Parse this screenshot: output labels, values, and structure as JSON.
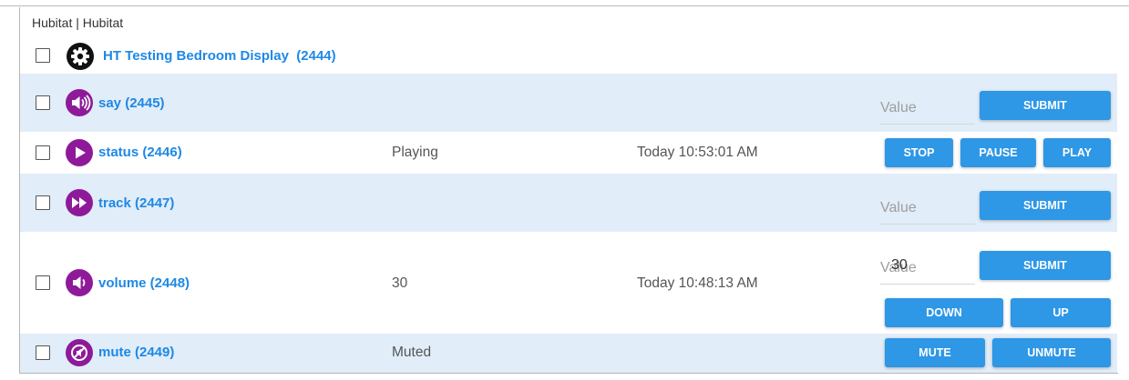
{
  "breadcrumb": "Hubitat | Hubitat",
  "parent_device": {
    "name": "HT Testing Bedroom Display",
    "id": "(2444)",
    "icon": "gear-icon"
  },
  "devices": [
    {
      "name": "say (2445)",
      "icon": "speaker-loud-icon",
      "input_placeholder": "Value",
      "submit_label": "SUBMIT"
    },
    {
      "name": "status (2446)",
      "icon": "play-icon",
      "value": "Playing",
      "time": "Today 10:53:01 AM",
      "buttons": [
        "STOP",
        "PAUSE",
        "PLAY"
      ]
    },
    {
      "name": "track (2447)",
      "icon": "fast-forward-icon",
      "input_placeholder": "Value",
      "submit_label": "SUBMIT"
    },
    {
      "name": "volume (2448)",
      "icon": "speaker-icon",
      "value": "30",
      "time": "Today 10:48:13 AM",
      "input_placeholder": "Value",
      "input_value": "30",
      "submit_label": "SUBMIT",
      "buttons": [
        "DOWN",
        "UP"
      ]
    },
    {
      "name": "mute (2449)",
      "icon": "mute-icon",
      "value": "Muted",
      "buttons": [
        "MUTE",
        "UNMUTE"
      ]
    }
  ],
  "colors": {
    "accent": "#2e97e6",
    "link": "#1e88e5",
    "icon_purple": "#8e1a9a",
    "row_shade": "#e1edf8"
  }
}
